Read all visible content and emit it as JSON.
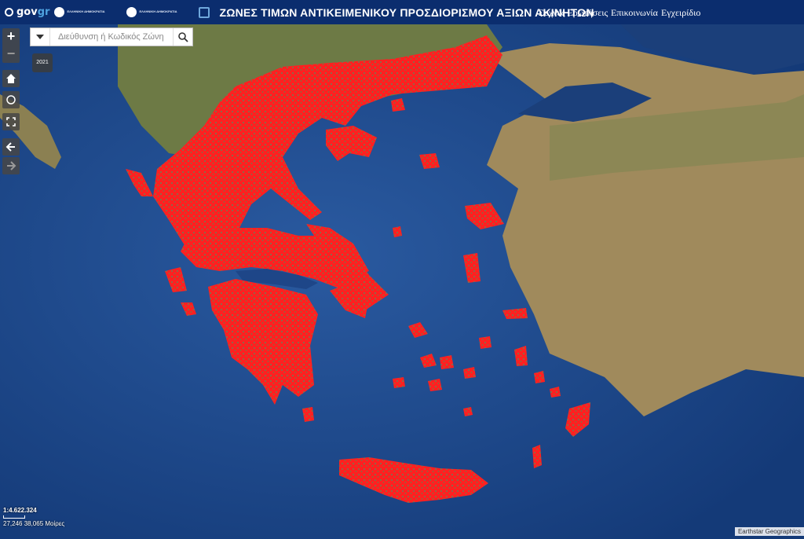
{
  "header": {
    "gov_logo_text": "gov",
    "gov_logo_suffix": "gr",
    "ministry_1": "ΕΛΛΗΝΙΚΗ ΔΗΜΟΚΡΑΤΙΑ",
    "ministry_2": "ΕΛΛΗΝΙΚΗ ΔΗΜΟΚΡΑΤΙΑ",
    "title": "ΖΩΝΕΣ ΤΙΜΩΝ ΑΝΤΙΚΕΙΜΕΝΙΚΟΥ ΠΡΟΣΔΙΟΡΙΣΜΟΥ ΑΞΙΩΝ ΑΚΙΝΗΤΩΝ",
    "nav": [
      "Συχνές Ερωτήσεις",
      "Επικοινωνία",
      "Εγχειρίδιο"
    ]
  },
  "search": {
    "placeholder": "Διεύθυνση ή Κωδικός Ζώνη"
  },
  "year_chip": "2021",
  "scale_text": "1:4.622.324",
  "coordinates": "27,246 38,065 Μοίρες",
  "attribution": "Earthstar Geographics",
  "colors": {
    "header_bg": "#0b2d6e",
    "sea": "#1f4f94",
    "zones": "#ff1e1e",
    "land": "#7e8a55"
  },
  "icons": [
    "home-icon",
    "locate-icon",
    "fullscreen-icon",
    "back-arrow-icon",
    "forward-arrow-icon",
    "search-icon",
    "dropdown-icon"
  ]
}
